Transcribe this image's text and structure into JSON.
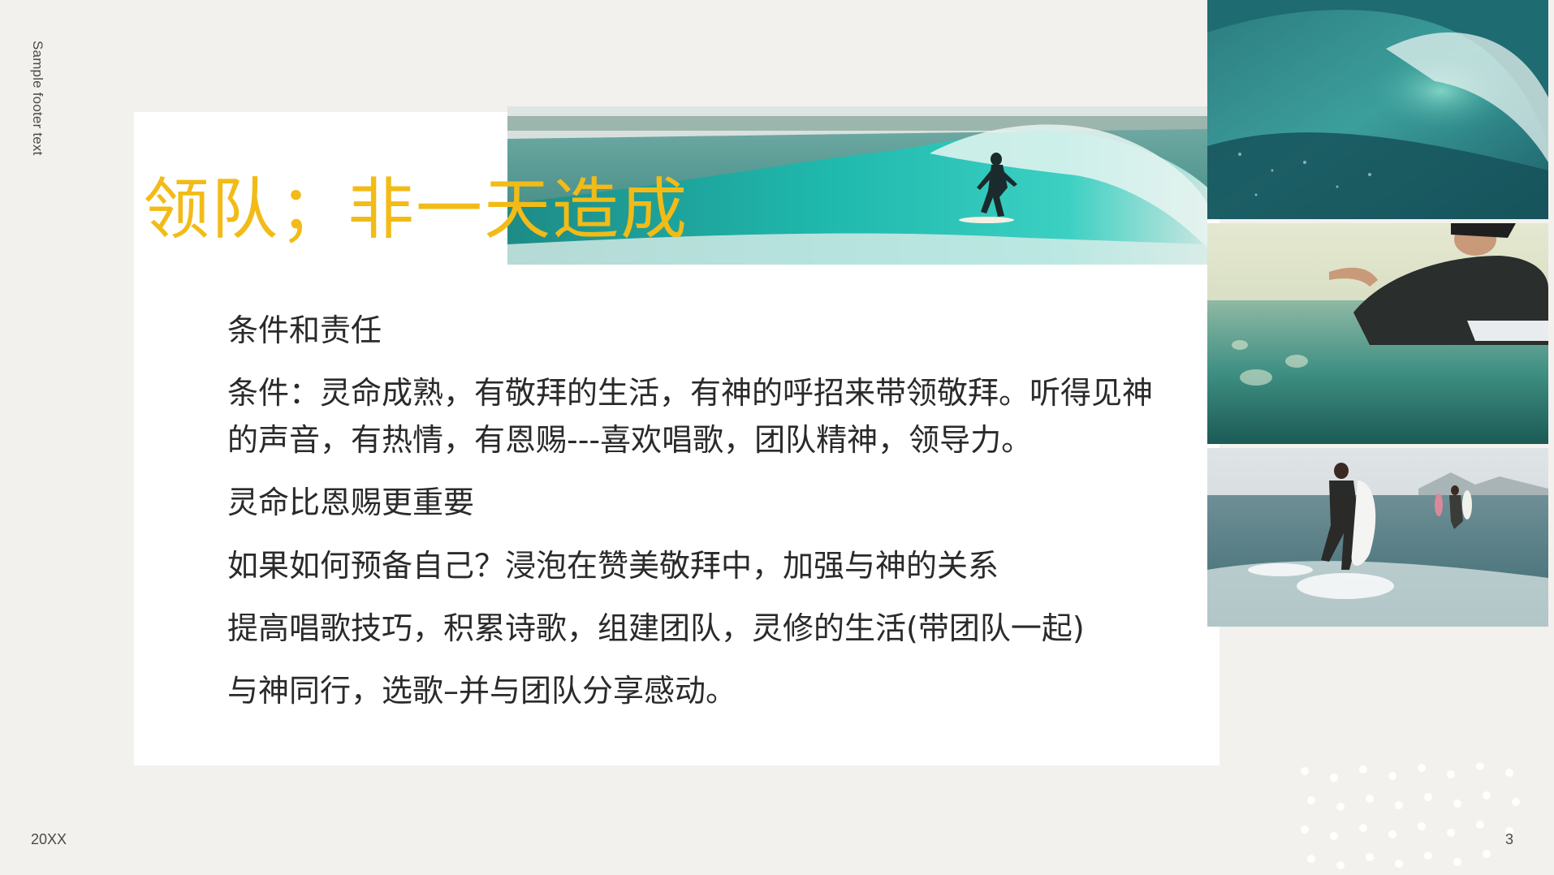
{
  "slide": {
    "footer_text": "Sample footer text",
    "date": "20XX",
    "page_number": "3",
    "title": "领队；非一天造成",
    "body": [
      "条件和责任",
      "条件：灵命成熟，有敬拜的生活，有神的呼招来带领敬拜。听得见神的声音，有热情，有恩赐---喜欢唱歌，团队精神，领导力。",
      "灵命比恩赐更重要",
      "如果如何预备自己？浸泡在赞美敬拜中，加强与神的关系",
      "提高唱歌技巧，积累诗歌，组建团队，灵修的生活(带团队一起)",
      "与神同行，选歌–并与团队分享感动。"
    ]
  },
  "colors": {
    "background": "#f3f1ee",
    "card": "#ffffff",
    "title": "#f2bb17",
    "body_text": "#2a2a2a"
  }
}
